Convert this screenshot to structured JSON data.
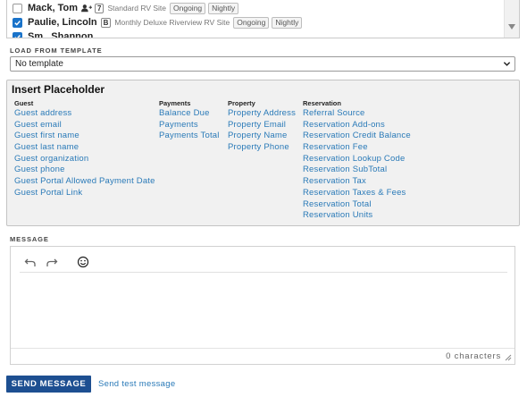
{
  "guests": [
    {
      "name": "Mack, Tom",
      "checked": false,
      "icon": "user-plus-icon",
      "badge": "7",
      "site": "Standard RV Site",
      "tags": [
        "Ongoing",
        "Nightly"
      ]
    },
    {
      "name": "Paulie, Lincoln",
      "checked": true,
      "icon": "",
      "badge": "B",
      "site": "Monthly Deluxe Riverview RV Site",
      "tags": [
        "Ongoing",
        "Nightly"
      ]
    },
    {
      "name": "Sm...Shannon",
      "checked": true,
      "icon": "",
      "badge": "",
      "site": "",
      "tags": []
    }
  ],
  "template": {
    "label": "LOAD FROM TEMPLATE",
    "selected": "No template"
  },
  "placeholders": {
    "title": "Insert Placeholder",
    "columns": [
      {
        "heading": "Guest",
        "items": [
          "Guest address",
          "Guest email",
          "Guest first name",
          "Guest last name",
          "Guest organization",
          "Guest phone",
          "Guest Portal Allowed Payment Date",
          "Guest Portal Link"
        ]
      },
      {
        "heading": "Payments",
        "items": [
          "Balance Due",
          "Payments",
          "Payments Total"
        ]
      },
      {
        "heading": "Property",
        "items": [
          "Property Address",
          "Property Email",
          "Property Name",
          "Property Phone"
        ]
      },
      {
        "heading": "Reservation",
        "items": [
          "Referral Source",
          "Reservation Add-ons",
          "Reservation Credit Balance",
          "Reservation Fee",
          "Reservation Lookup Code",
          "Reservation SubTotal",
          "Reservation Tax",
          "Reservation Taxes & Fees",
          "Reservation Total",
          "Reservation Units"
        ]
      }
    ]
  },
  "message": {
    "label": "MESSAGE",
    "char_count": "0 characters",
    "toolbar": [
      "undo-icon",
      "redo-icon",
      "emoji-icon"
    ]
  },
  "actions": {
    "send_label": "SEND MESSAGE",
    "test_label": "Send test message"
  },
  "colors": {
    "link": "#2a7ab8",
    "primary_button": "#1d4f91",
    "checkbox": "#1a73c9",
    "panel_bg": "#f1f1f1"
  }
}
